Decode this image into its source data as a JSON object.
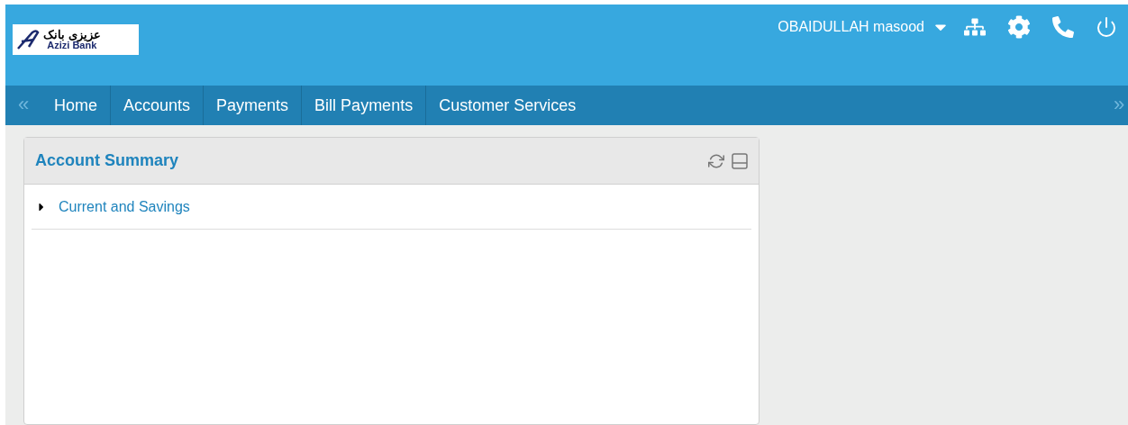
{
  "logo": {
    "native_name": "عزيزى بانک",
    "name": "Azizi Bank"
  },
  "user": {
    "name": "OBAIDULLAH masood"
  },
  "nav": {
    "prev": "«",
    "next": "»",
    "items": [
      {
        "label": "Home",
        "selected": false
      },
      {
        "label": "Accounts",
        "selected": false
      },
      {
        "label": "Payments",
        "selected": false
      },
      {
        "label": "Bill Payments",
        "selected": false
      },
      {
        "label": "Customer Services",
        "selected": false
      }
    ]
  },
  "panel": {
    "title": "Account Summary",
    "groups": [
      {
        "label": "Current and Savings",
        "expanded": false
      }
    ]
  }
}
